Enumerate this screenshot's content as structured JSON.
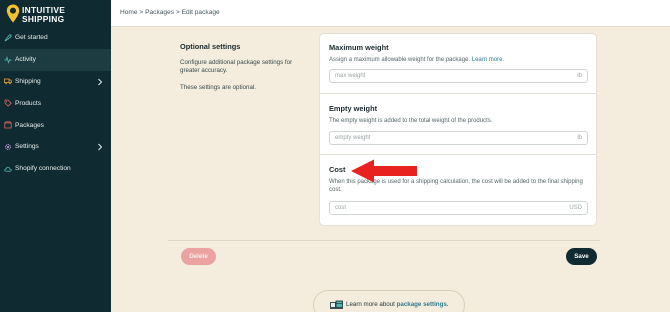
{
  "app": {
    "logo_text_line1": "INTUITIVE",
    "logo_text_line2": "SHIPPING"
  },
  "sidebar": {
    "items": [
      {
        "label": "Get started",
        "icon": "rocket-icon",
        "has_chevron": false,
        "active": false
      },
      {
        "label": "Activity",
        "icon": "activity-icon",
        "has_chevron": false,
        "active": true
      },
      {
        "label": "Shipping",
        "icon": "truck-icon",
        "has_chevron": true,
        "active": false
      },
      {
        "label": "Products",
        "icon": "tag-icon",
        "has_chevron": false,
        "active": false
      },
      {
        "label": "Packages",
        "icon": "box-icon",
        "has_chevron": false,
        "active": false
      },
      {
        "label": "Settings",
        "icon": "gear-icon",
        "has_chevron": true,
        "active": false
      },
      {
        "label": "Shopify connection",
        "icon": "cloud-icon",
        "has_chevron": false,
        "active": false
      }
    ]
  },
  "breadcrumb": {
    "text": "Home > Packages > Edit package"
  },
  "optional": {
    "title": "Optional settings",
    "description": "Configure additional package settings for greater accuracy.",
    "note": "These settings are optional."
  },
  "fields": {
    "max_weight": {
      "title": "Maximum weight",
      "help": "Assign a maximum allowable weight for the package.",
      "help_link": "Learn more.",
      "placeholder": "max weight",
      "suffix": "lb"
    },
    "empty_weight": {
      "title": "Empty weight",
      "help": "The empty weight is added to the total weight of the products.",
      "placeholder": "empty weight",
      "suffix": "lb"
    },
    "cost": {
      "title": "Cost",
      "help": "When this package is used for a shipping calculation, the cost will be added to the final shipping cost.",
      "placeholder": "cost",
      "suffix": "USD"
    }
  },
  "actions": {
    "delete_label": "Delete",
    "save_label": "Save"
  },
  "learn_more": {
    "prefix": "Learn more about",
    "link": "package settings."
  },
  "colors": {
    "sidebar_bg": "#0f2a30",
    "page_bg": "#f4ecdc",
    "accent_link": "#2d7e8f",
    "delete_bg": "#eaa3a0",
    "arrow": "#e8231f",
    "logo_pin": "#f2c230"
  }
}
